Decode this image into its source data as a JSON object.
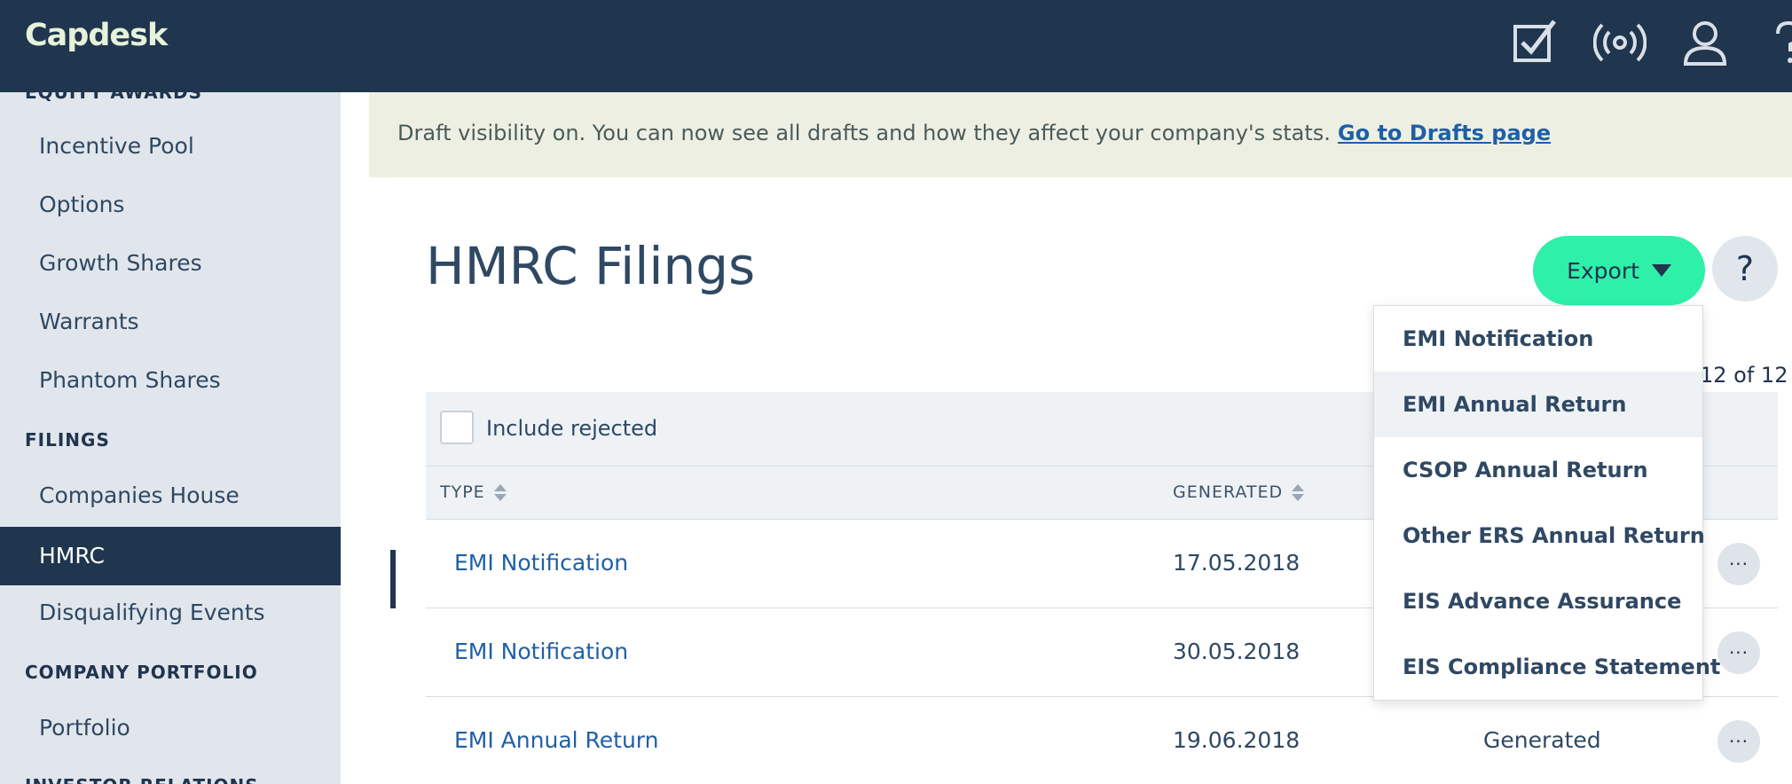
{
  "app": {
    "logo": "Capdesk"
  },
  "topbar": {
    "icons": [
      "checklist-icon",
      "broadcast-icon",
      "user-icon",
      "help-icon"
    ]
  },
  "sidebar": {
    "cut_heading": "EQUITY AWARDS",
    "items_top": [
      {
        "label": "Incentive Pool"
      },
      {
        "label": "Options"
      },
      {
        "label": "Growth Shares"
      },
      {
        "label": "Warrants"
      },
      {
        "label": "Phantom Shares"
      }
    ],
    "filings_heading": "FILINGS",
    "filings_items": [
      {
        "label": "Companies House"
      },
      {
        "label": "HMRC",
        "active": true
      },
      {
        "label": "Disqualifying Events"
      }
    ],
    "portfolio_heading": "COMPANY PORTFOLIO",
    "portfolio_items": [
      {
        "label": "Portfolio"
      }
    ],
    "investor_heading": "INVESTOR RELATIONS"
  },
  "banner": {
    "text": "Draft visibility on. You can now see all drafts and how they affect your company's stats.",
    "link": "Go to Drafts page"
  },
  "page": {
    "title": "HMRC Filings",
    "export_label": "Export",
    "help_label": "?",
    "count_text": "12 of 12"
  },
  "filter": {
    "include_rejected": "Include rejected",
    "include_rejected_checked": false
  },
  "table": {
    "columns": [
      "TYPE",
      "GENERATED"
    ],
    "rows": [
      {
        "type": "EMI Notification",
        "generated": "17.05.2018",
        "status": ""
      },
      {
        "type": "EMI Notification",
        "generated": "30.05.2018",
        "status": ""
      },
      {
        "type": "EMI Annual Return",
        "generated": "19.06.2018",
        "status": "Generated"
      }
    ],
    "row_menu": "···"
  },
  "export_menu": {
    "items": [
      {
        "label": "EMI Notification"
      },
      {
        "label": "EMI Annual Return",
        "hover": true
      },
      {
        "label": "CSOP Annual Return"
      },
      {
        "label": "Other ERS Annual Return"
      },
      {
        "label": "EIS Advance Assurance"
      },
      {
        "label": "EIS Compliance Statement"
      }
    ]
  },
  "colors": {
    "topbar": "#20354e",
    "accent": "#2ef0a8",
    "link": "#1f5fa8",
    "sidebar_bg": "#e1e6ec",
    "banner_bg": "#eeefe3"
  }
}
